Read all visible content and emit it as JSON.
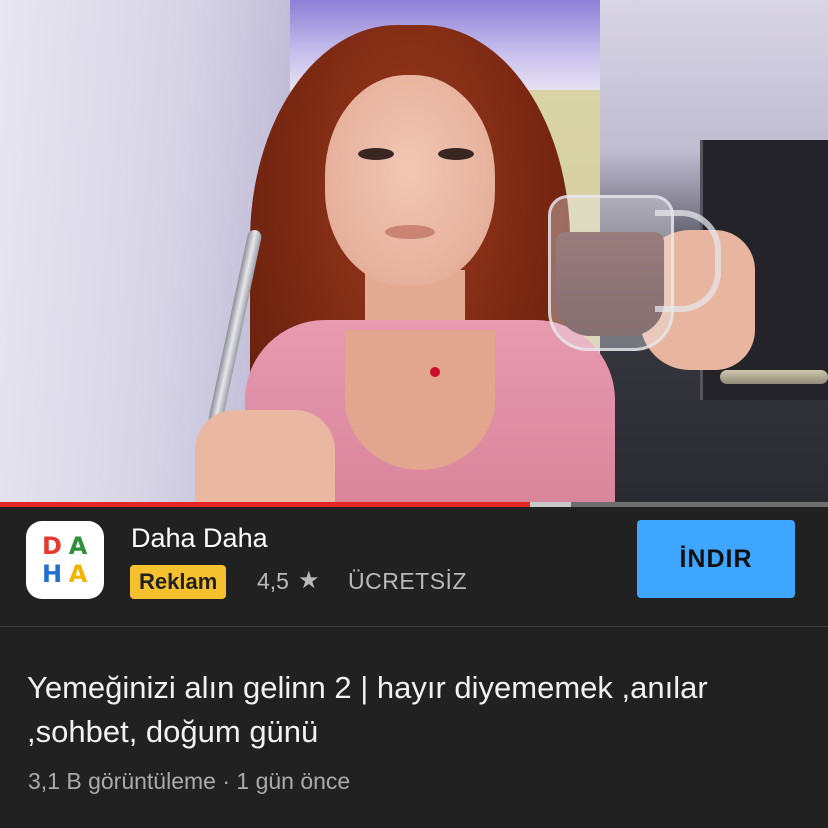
{
  "video": {
    "progress_fraction": 0.64,
    "buffered_fraction": 0.69
  },
  "ad": {
    "app_name": "Daha Daha",
    "badge": "Reklam",
    "rating": "4,5",
    "star_icon": "star-icon",
    "price_label": "ÜCRETSİZ",
    "install_label": "İNDIR",
    "logo_letters": [
      "D",
      "A",
      "H",
      "A"
    ],
    "colors": {
      "badge": "#f5c12f",
      "install_button": "#3ea6ff",
      "progress": "#e52521",
      "logo_d": "#e43a2f",
      "logo_a1": "#2f8f3a",
      "logo_h": "#1f6fd0",
      "logo_a2": "#f0b400"
    }
  },
  "video_info": {
    "title": "Yemeğinizi alın gelinn 2 | hayır diyememek ,anılar ,sohbet, doğum günü",
    "views": "3,1 B görüntüleme",
    "separator": "·",
    "age": "1 gün önce"
  }
}
